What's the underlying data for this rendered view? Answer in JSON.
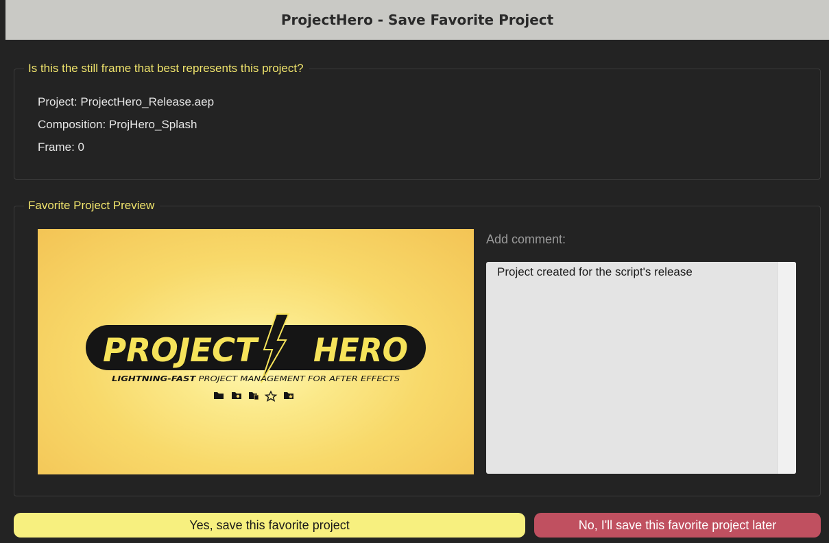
{
  "window": {
    "title": "ProjectHero - Save Favorite Project"
  },
  "info_panel": {
    "title": "Is this the still frame that best represents this project?",
    "project_line": "Project: ProjectHero_Release.aep",
    "composition_line": "Composition: ProjHero_Splash",
    "frame_line": "Frame: 0"
  },
  "preview_panel": {
    "title": "Favorite Project Preview",
    "logo": {
      "word_left": "PROJECT",
      "word_right": "HERO",
      "tagline_bold": "LIGHTNING-FAST",
      "tagline_rest": " PROJECT MANAGEMENT FOR AFTER EFFECTS",
      "icons": [
        "folder-icon",
        "folder-search-icon",
        "folder-copy-icon",
        "star-icon",
        "folder-star-icon"
      ]
    },
    "comment_label": "Add comment:",
    "comment_value": "Project created for the script's release"
  },
  "buttons": {
    "yes_label": "Yes, save this favorite project",
    "no_label": "No, I'll save this favorite project later"
  },
  "colors": {
    "accent_yellow": "#f7f07f",
    "title_yellow": "#f0e46c",
    "danger_red": "#c05060",
    "background": "#232323"
  }
}
